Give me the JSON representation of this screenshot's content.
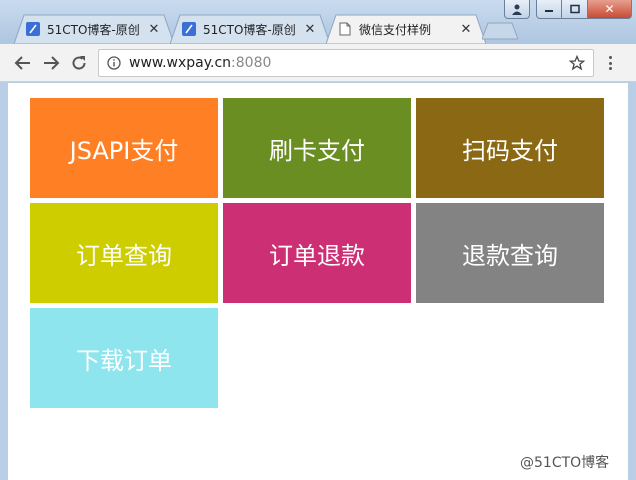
{
  "browser": {
    "tabs": [
      {
        "label": "51CTO博客-原创"
      },
      {
        "label": "51CTO博客-原创"
      },
      {
        "label": "微信支付样例"
      }
    ],
    "address": {
      "host": "www.wxpay.cn",
      "port": ":8080"
    }
  },
  "tiles": [
    {
      "label": "JSAPI支付",
      "color": "#ff7f24"
    },
    {
      "label": "刷卡支付",
      "color": "#6b8e23"
    },
    {
      "label": "扫码支付",
      "color": "#8b6914"
    },
    {
      "label": "订单查询",
      "color": "#cdcd00"
    },
    {
      "label": "订单退款",
      "color": "#cd2f74"
    },
    {
      "label": "退款查询",
      "color": "#838383"
    },
    {
      "label": "下载订单",
      "color": "#8ee5ee"
    }
  ],
  "watermark": "@51CTO博客"
}
